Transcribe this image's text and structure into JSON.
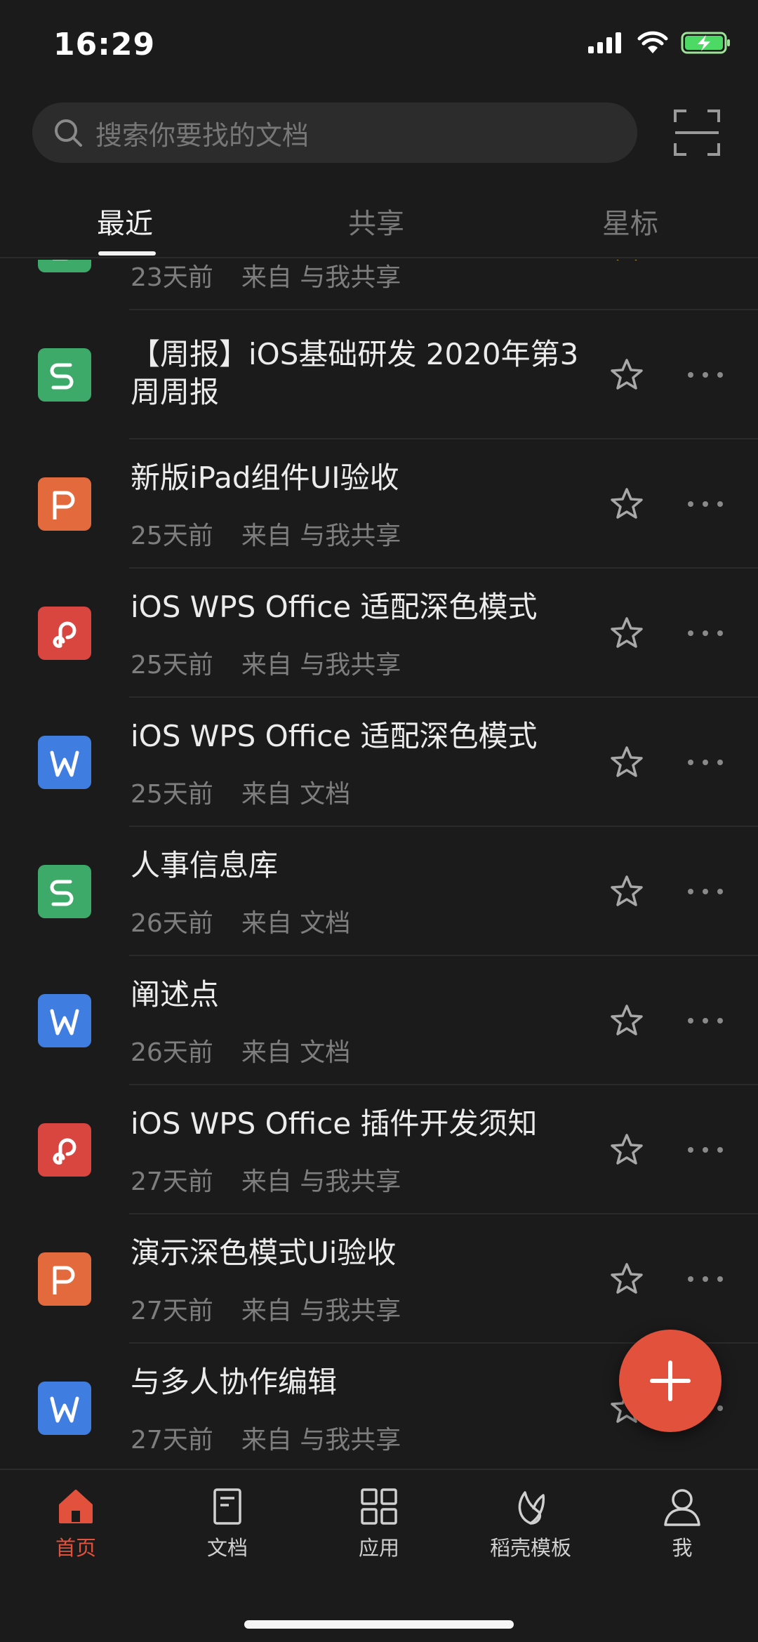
{
  "status_bar": {
    "time": "16:29"
  },
  "search": {
    "placeholder": "搜索你要找的文档"
  },
  "tabs": [
    {
      "label": "最近",
      "active": true
    },
    {
      "label": "共享",
      "active": false
    },
    {
      "label": "星标",
      "active": false
    }
  ],
  "files": [
    {
      "type": "sheet",
      "icon": "s-sheet-icon",
      "color": "#3daa6a",
      "title": "",
      "time": "23天前",
      "source": "来自 与我共享",
      "starred": true
    },
    {
      "type": "sheet",
      "icon": "s-sheet-icon",
      "color": "#3daa6a",
      "title": "【周报】iOS基础研发 2020年第3周周报",
      "time": "",
      "source": "",
      "starred": false
    },
    {
      "type": "presentation",
      "icon": "p-presentation-icon",
      "color": "#e26a3c",
      "title": "新版iPad组件UI验收",
      "time": "25天前",
      "source": "来自 与我共享",
      "starred": false
    },
    {
      "type": "pdf",
      "icon": "pdf-icon",
      "color": "#d9453f",
      "title": "iOS WPS Office 适配深色模式",
      "time": "25天前",
      "source": "来自 与我共享",
      "starred": false
    },
    {
      "type": "word",
      "icon": "w-document-icon",
      "color": "#3f7ee0",
      "title": "iOS WPS Office 适配深色模式",
      "time": "25天前",
      "source": "来自 文档",
      "starred": false
    },
    {
      "type": "sheet",
      "icon": "s-sheet-icon",
      "color": "#3daa6a",
      "title": "人事信息库",
      "time": "26天前",
      "source": "来自 文档",
      "starred": false
    },
    {
      "type": "word",
      "icon": "w-document-icon",
      "color": "#3f7ee0",
      "title": "阐述点",
      "time": "26天前",
      "source": "来自 文档",
      "starred": false
    },
    {
      "type": "pdf",
      "icon": "pdf-icon",
      "color": "#d9453f",
      "title": "iOS WPS Office 插件开发须知",
      "time": "27天前",
      "source": "来自 与我共享",
      "starred": false
    },
    {
      "type": "presentation",
      "icon": "p-presentation-icon",
      "color": "#e26a3c",
      "title": "演示深色模式Ui验收",
      "time": "27天前",
      "source": "来自 与我共享",
      "starred": false
    },
    {
      "type": "word",
      "icon": "w-document-icon",
      "color": "#3f7ee0",
      "title": "与多人协作编辑",
      "time": "27天前",
      "source": "来自 与我共享",
      "starred": false
    }
  ],
  "fab": {
    "icon": "plus-icon",
    "color": "#e2513c"
  },
  "bottom_nav": [
    {
      "label": "首页",
      "icon": "home-icon",
      "active": true
    },
    {
      "label": "文档",
      "icon": "document-icon",
      "active": false
    },
    {
      "label": "应用",
      "icon": "apps-grid-icon",
      "active": false
    },
    {
      "label": "稻壳模板",
      "icon": "leaf-icon",
      "active": false
    },
    {
      "label": "我",
      "icon": "user-icon",
      "active": false
    }
  ],
  "colors": {
    "accent": "#e2513c",
    "background": "#1b1b1b",
    "star_active": "#f1c232"
  }
}
